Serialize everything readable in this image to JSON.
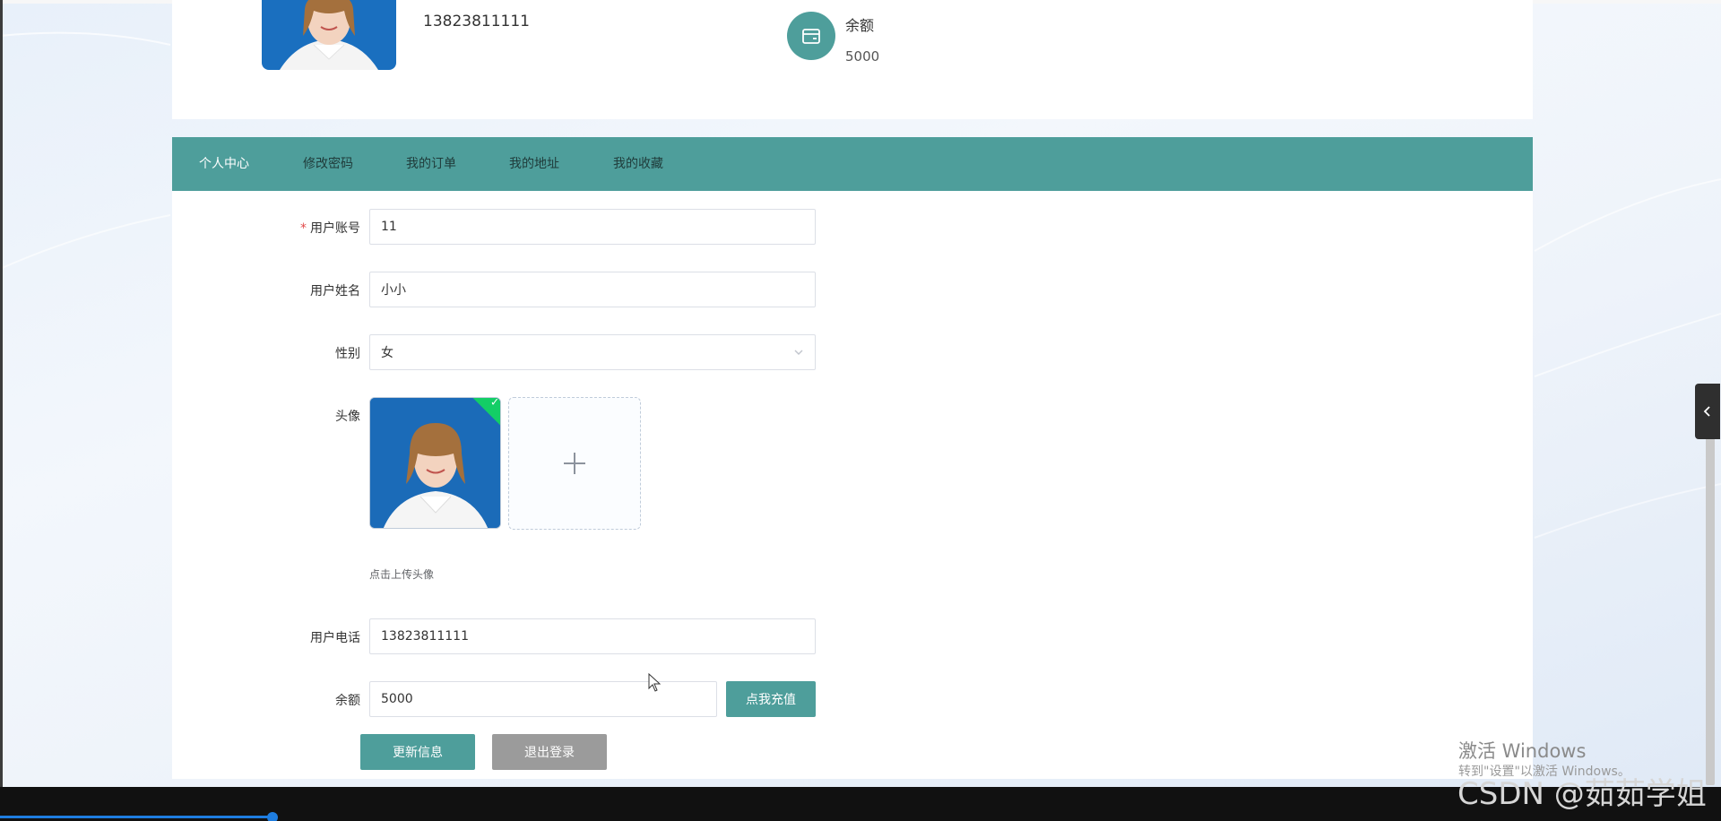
{
  "profile": {
    "phone": "13823811111",
    "balance_title": "余额",
    "balance_value": "5000"
  },
  "nav": {
    "items": [
      {
        "label": "个人中心",
        "active": true
      },
      {
        "label": "修改密码",
        "active": false
      },
      {
        "label": "我的订单",
        "active": false
      },
      {
        "label": "我的地址",
        "active": false
      },
      {
        "label": "我的收藏",
        "active": false
      }
    ]
  },
  "form": {
    "account": {
      "label": "用户账号",
      "value": "11"
    },
    "name": {
      "label": "用户姓名",
      "value": "小小"
    },
    "gender": {
      "label": "性别",
      "value": "女"
    },
    "avatar": {
      "label": "头像",
      "hint": "点击上传头像"
    },
    "phone": {
      "label": "用户电话",
      "value": "13823811111"
    },
    "balance": {
      "label": "余额",
      "value": "5000",
      "recharge_label": "点我充值"
    },
    "update_label": "更新信息",
    "logout_label": "退出登录"
  },
  "watermark": {
    "activate_title": "激活 Windows",
    "activate_sub": "转到\"设置\"以激活 Windows。",
    "csdn": "CSDN @茹茹学姐"
  },
  "colors": {
    "accent": "#4e9e9b",
    "nav_bg": "#4e9e9b",
    "logout_bg": "#9b9b9b",
    "upload_success": "#13ce66"
  }
}
